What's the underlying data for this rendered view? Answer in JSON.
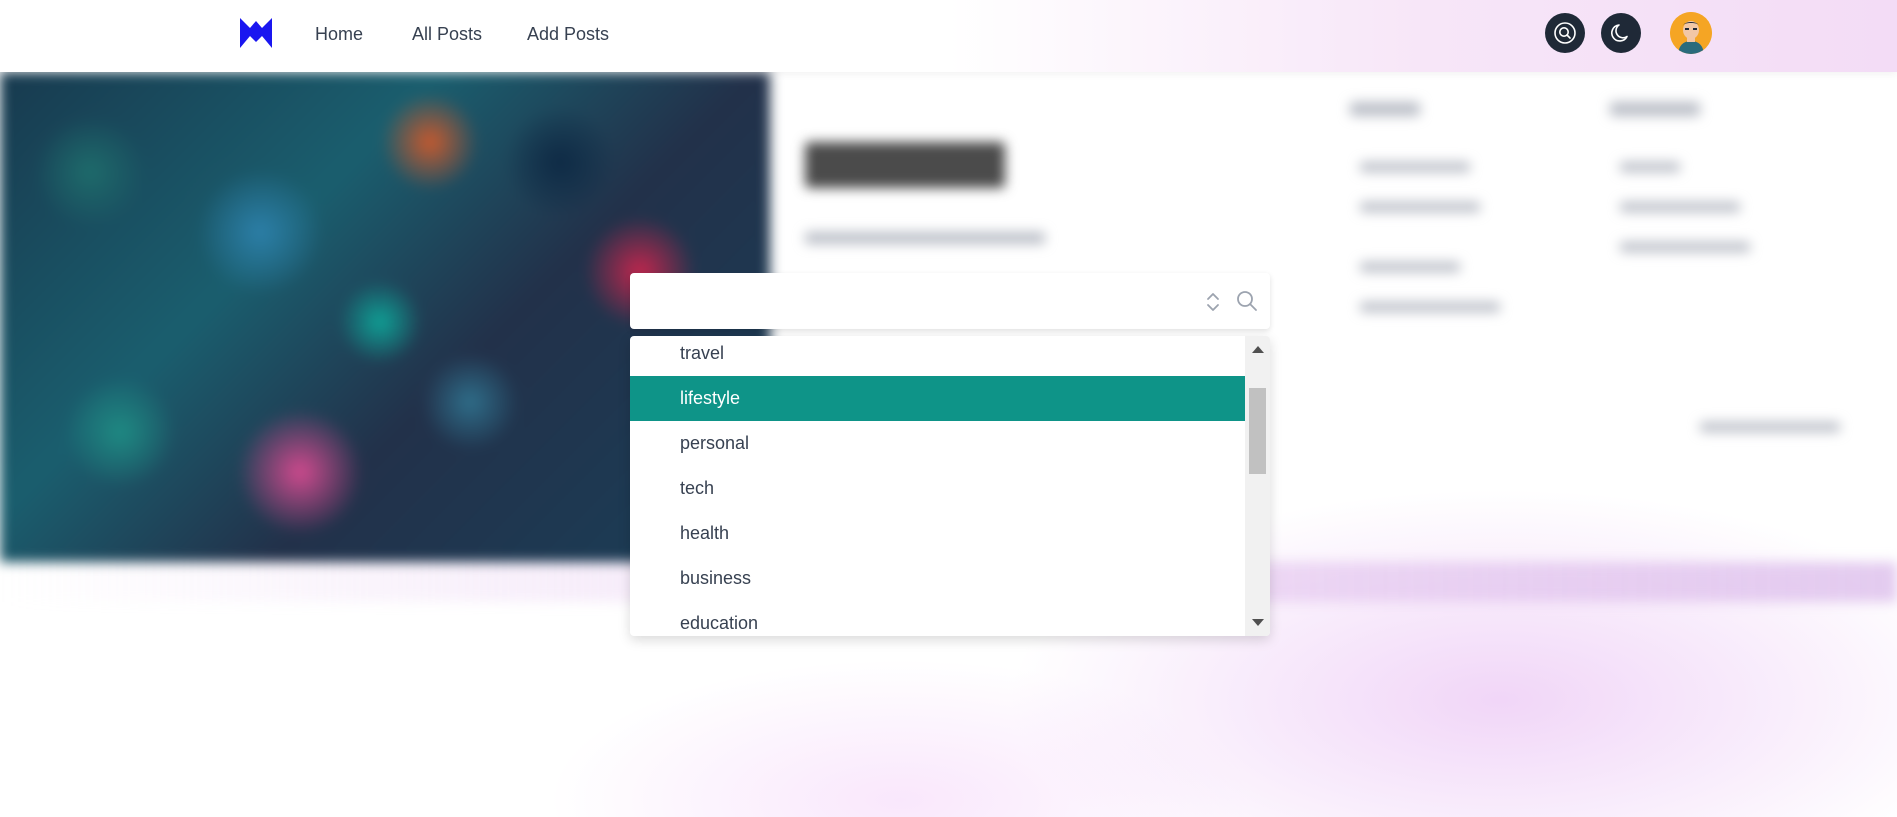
{
  "nav": {
    "home": "Home",
    "all_posts": "All Posts",
    "add_posts": "Add Posts"
  },
  "brand": {
    "logo_color": "#1a16f0"
  },
  "icons": {
    "search": "search-circle-icon",
    "theme": "moon-icon",
    "avatar": "user-avatar"
  },
  "search": {
    "value": "",
    "placeholder": ""
  },
  "dropdown": {
    "options": [
      "travel",
      "lifestyle",
      "personal",
      "tech",
      "health",
      "business",
      "education"
    ],
    "selected": "lifestyle",
    "highlight_color": "#0e9488"
  }
}
